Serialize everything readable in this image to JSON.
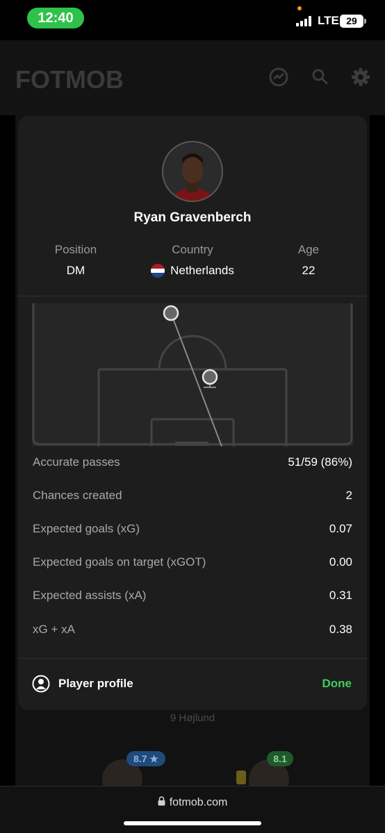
{
  "status_bar": {
    "time": "12:40",
    "network": "LTE",
    "battery": "29"
  },
  "header": {
    "logo": "FOTMOB",
    "icons": [
      "transfer-icon",
      "search-icon",
      "gear-icon"
    ]
  },
  "player": {
    "name": "Ryan Gravenberch",
    "info": [
      {
        "label": "Position",
        "value": "DM"
      },
      {
        "label": "Country",
        "value": "Netherlands"
      },
      {
        "label": "Age",
        "value": "22"
      }
    ]
  },
  "stats": [
    {
      "label": "Accurate passes",
      "value": "51/59 (86%)"
    },
    {
      "label": "Chances created",
      "value": "2"
    },
    {
      "label": "Expected goals (xG)",
      "value": "0.07"
    },
    {
      "label": "Expected goals on target (xGOT)",
      "value": "0.00"
    },
    {
      "label": "Expected assists (xA)",
      "value": "0.31"
    },
    {
      "label": "xG + xA",
      "value": "0.38"
    }
  ],
  "footer": {
    "profile_label": "Player profile",
    "done_label": "Done"
  },
  "background": {
    "sub_label": "9 Højlund",
    "ratings": [
      "8.7 ★",
      "8.1"
    ]
  },
  "browser": {
    "url": "fotmob.com"
  },
  "colors": {
    "accent_green": "#3ecf59",
    "card_bg": "#1d1d1d",
    "rating_blue": "#2e6fb8",
    "rating_green": "#2b8a3e"
  }
}
